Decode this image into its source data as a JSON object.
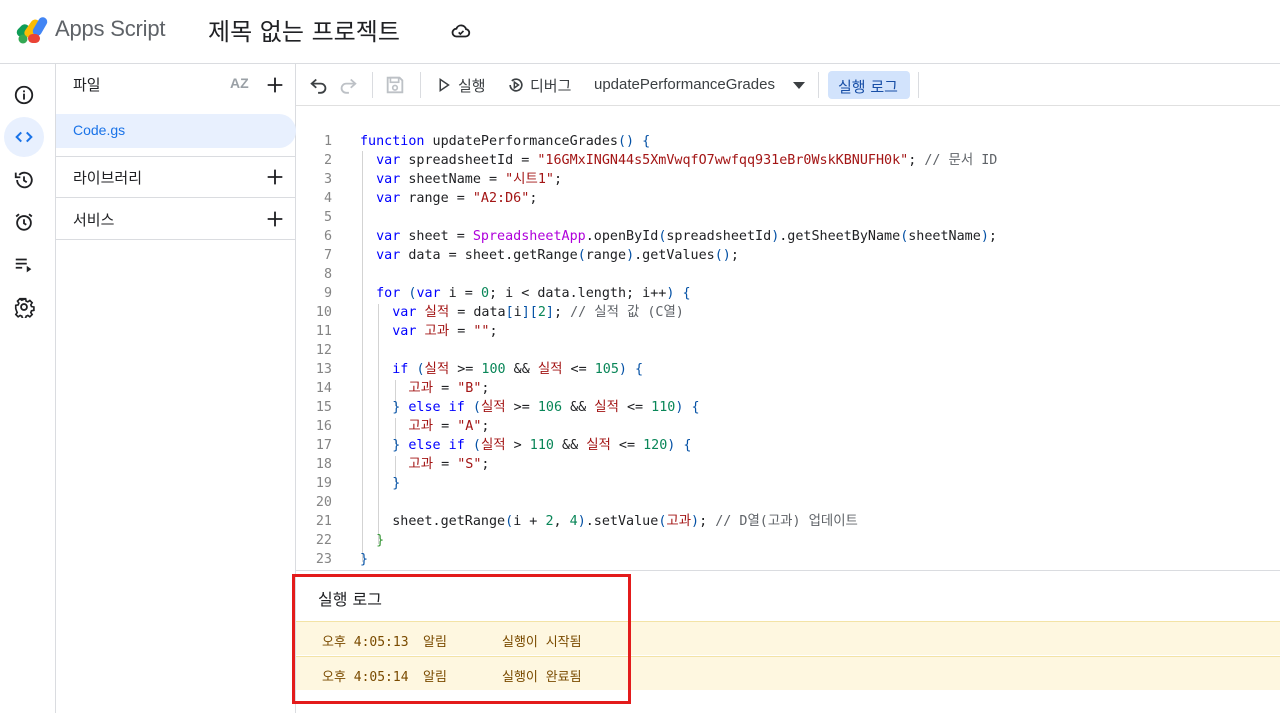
{
  "header": {
    "app_name": "Apps Script",
    "project_title": "제목 없는 프로젝트"
  },
  "files_panel": {
    "files_label": "파일",
    "sort_label": "AZ",
    "active_file": "Code.gs",
    "libraries_label": "라이브러리",
    "services_label": "서비스"
  },
  "toolbar": {
    "run_label": "실행",
    "debug_label": "디버그",
    "function_name": "updatePerformanceGrades",
    "exec_log_label": "실행 로그"
  },
  "editor": {
    "line_numbers": [
      "1",
      "2",
      "3",
      "4",
      "5",
      "6",
      "7",
      "8",
      "9",
      "10",
      "11",
      "12",
      "13",
      "14",
      "15",
      "16",
      "17",
      "18",
      "19",
      "20",
      "21",
      "22",
      "23"
    ]
  },
  "log": {
    "title": "실행 로그",
    "entries": [
      {
        "time": "오후 4:05:13",
        "level": "알림",
        "message": "실행이 시작됨"
      },
      {
        "time": "오후 4:05:14",
        "level": "알림",
        "message": "실행이 완료됨"
      }
    ]
  },
  "colors": {
    "accent": "#1a73e8",
    "active_bg": "#e8f0fe",
    "log_row_bg": "#fef7e0",
    "highlight_box": "#e31b1b"
  }
}
